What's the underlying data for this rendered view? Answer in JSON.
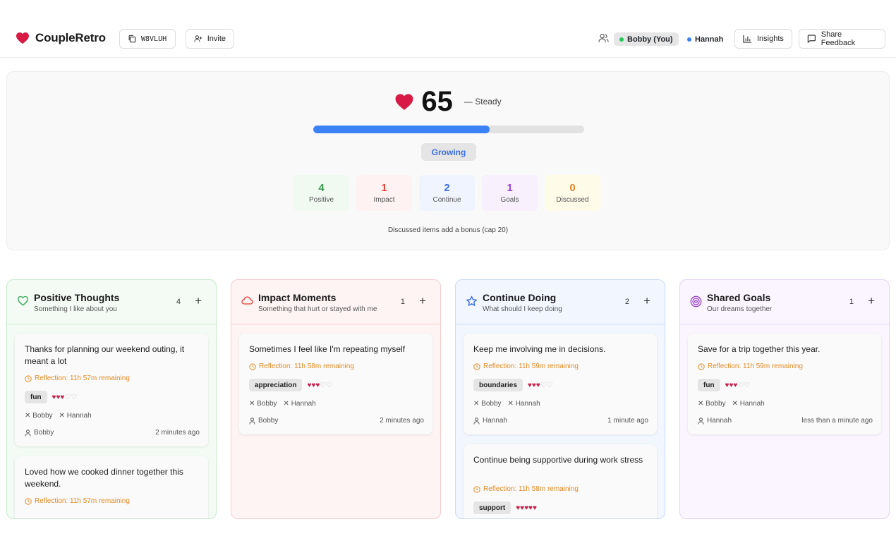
{
  "brand": {
    "name": "CoupleRetro",
    "heart_color": "#d81b45"
  },
  "header": {
    "room_code": "W8VLUH",
    "invite_label": "Invite",
    "users": [
      {
        "name": "Bobby (You)",
        "dot_color": "#22c55e"
      },
      {
        "name": "Hannah",
        "dot_color": "#3b82f6"
      }
    ],
    "insights_label": "Insights",
    "share_label": "Share Feedback"
  },
  "score": {
    "value": "65",
    "status": "— Steady",
    "progress_percent": 65,
    "stage": "Growing",
    "bonus_note": "Discussed items add a bonus (cap 20)",
    "stats": [
      {
        "value": "4",
        "label": "Positive",
        "color": "#3a9b52",
        "bg": "#f0faf1"
      },
      {
        "value": "1",
        "label": "Impact",
        "color": "#e0483c",
        "bg": "#fff2f2"
      },
      {
        "value": "2",
        "label": "Continue",
        "color": "#3b6fe0",
        "bg": "#eff4ff"
      },
      {
        "value": "1",
        "label": "Goals",
        "color": "#9b44c9",
        "bg": "#f8f1fd"
      },
      {
        "value": "0",
        "label": "Discussed",
        "color": "#e0862a",
        "bg": "#fffbe9"
      }
    ]
  },
  "columns": [
    {
      "title": "Positive Thoughts",
      "subtitle": "Something I like about you",
      "count": "4",
      "icon": "heart-outline-icon",
      "accent": "#3aa95a",
      "bg": "#f3fbf4",
      "border": "#c9eccd",
      "cards": [
        {
          "text": "Thanks for planning our weekend outing, it meant a lot",
          "reflection": "Reflection: 11h 57m remaining",
          "tag": "fun",
          "rating": 3,
          "people": [
            "Bobby",
            "Hannah"
          ],
          "author": "Bobby",
          "time": "2 minutes ago"
        },
        {
          "text": "Loved how we cooked dinner together this weekend.",
          "reflection": "Reflection: 11h 57m remaining"
        }
      ]
    },
    {
      "title": "Impact Moments",
      "subtitle": "Something that hurt or stayed with me",
      "count": "1",
      "icon": "cloud-icon",
      "accent": "#e2483c",
      "bg": "#fff4f4",
      "border": "#f6cccc",
      "cards": [
        {
          "text": "Sometimes I feel like I'm repeating myself",
          "reflection": "Reflection: 11h 58m remaining",
          "tag": "appreciation",
          "rating": 3,
          "people": [
            "Bobby",
            "Hannah"
          ],
          "author": "Bobby",
          "time": "2 minutes ago"
        }
      ]
    },
    {
      "title": "Continue Doing",
      "subtitle": "What should I keep doing",
      "count": "2",
      "icon": "star-outline-icon",
      "accent": "#3b6fe0",
      "bg": "#f1f6ff",
      "border": "#c9dbf7",
      "cards": [
        {
          "text": "Keep me involving me in decisions.",
          "reflection": "Reflection: 11h 59m remaining",
          "tag": "boundaries",
          "rating": 3,
          "people": [
            "Bobby",
            "Hannah"
          ],
          "author": "Hannah",
          "time": "1 minute ago"
        },
        {
          "text": "Continue being supportive during work stress",
          "reflection": "Reflection: 11h 58m remaining",
          "tag": "support",
          "rating": 5
        }
      ]
    },
    {
      "title": "Shared Goals",
      "subtitle": "Our dreams together",
      "count": "1",
      "icon": "target-icon",
      "accent": "#9b44c9",
      "bg": "#faf5fe",
      "border": "#e6d3f4",
      "cards": [
        {
          "text": "Save for a trip together this year.",
          "reflection": "Reflection: 11h 59m remaining",
          "tag": "fun",
          "rating": 3,
          "people": [
            "Bobby",
            "Hannah"
          ],
          "author": "Hannah",
          "time": "less than a minute ago"
        }
      ]
    }
  ]
}
